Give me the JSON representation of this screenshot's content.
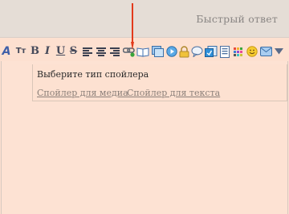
{
  "header": {
    "title": "Быстрый ответ"
  },
  "toolbar": {
    "icons": [
      "font-color-icon",
      "font-size-icon",
      "bold-icon",
      "italic-icon",
      "underline-icon",
      "strikethrough-icon",
      "align-left-icon",
      "align-center-icon",
      "align-right-icon",
      "link-icon",
      "spoiler-book-icon",
      "image-icon",
      "media-play-icon",
      "lock-icon",
      "quote-bubble-icon",
      "code-icon",
      "list-icon",
      "color-palette-icon",
      "smiley-icon",
      "mail-icon",
      "more-dropdown-icon"
    ],
    "font_label": "A",
    "size_label": "Tт",
    "bold_label": "B",
    "italic_label": "I",
    "underline_label": "U",
    "strike_label": "S"
  },
  "spoiler_menu": {
    "title": "Выберите тип спойлера",
    "option_media": "Спойлер для медиа",
    "option_text": "Спойлер для текста"
  },
  "colors": {
    "background": "#fde0d0",
    "header_bar": "#e5ddd6",
    "arrow": "#e23a1c",
    "link": "#8b7f79"
  }
}
